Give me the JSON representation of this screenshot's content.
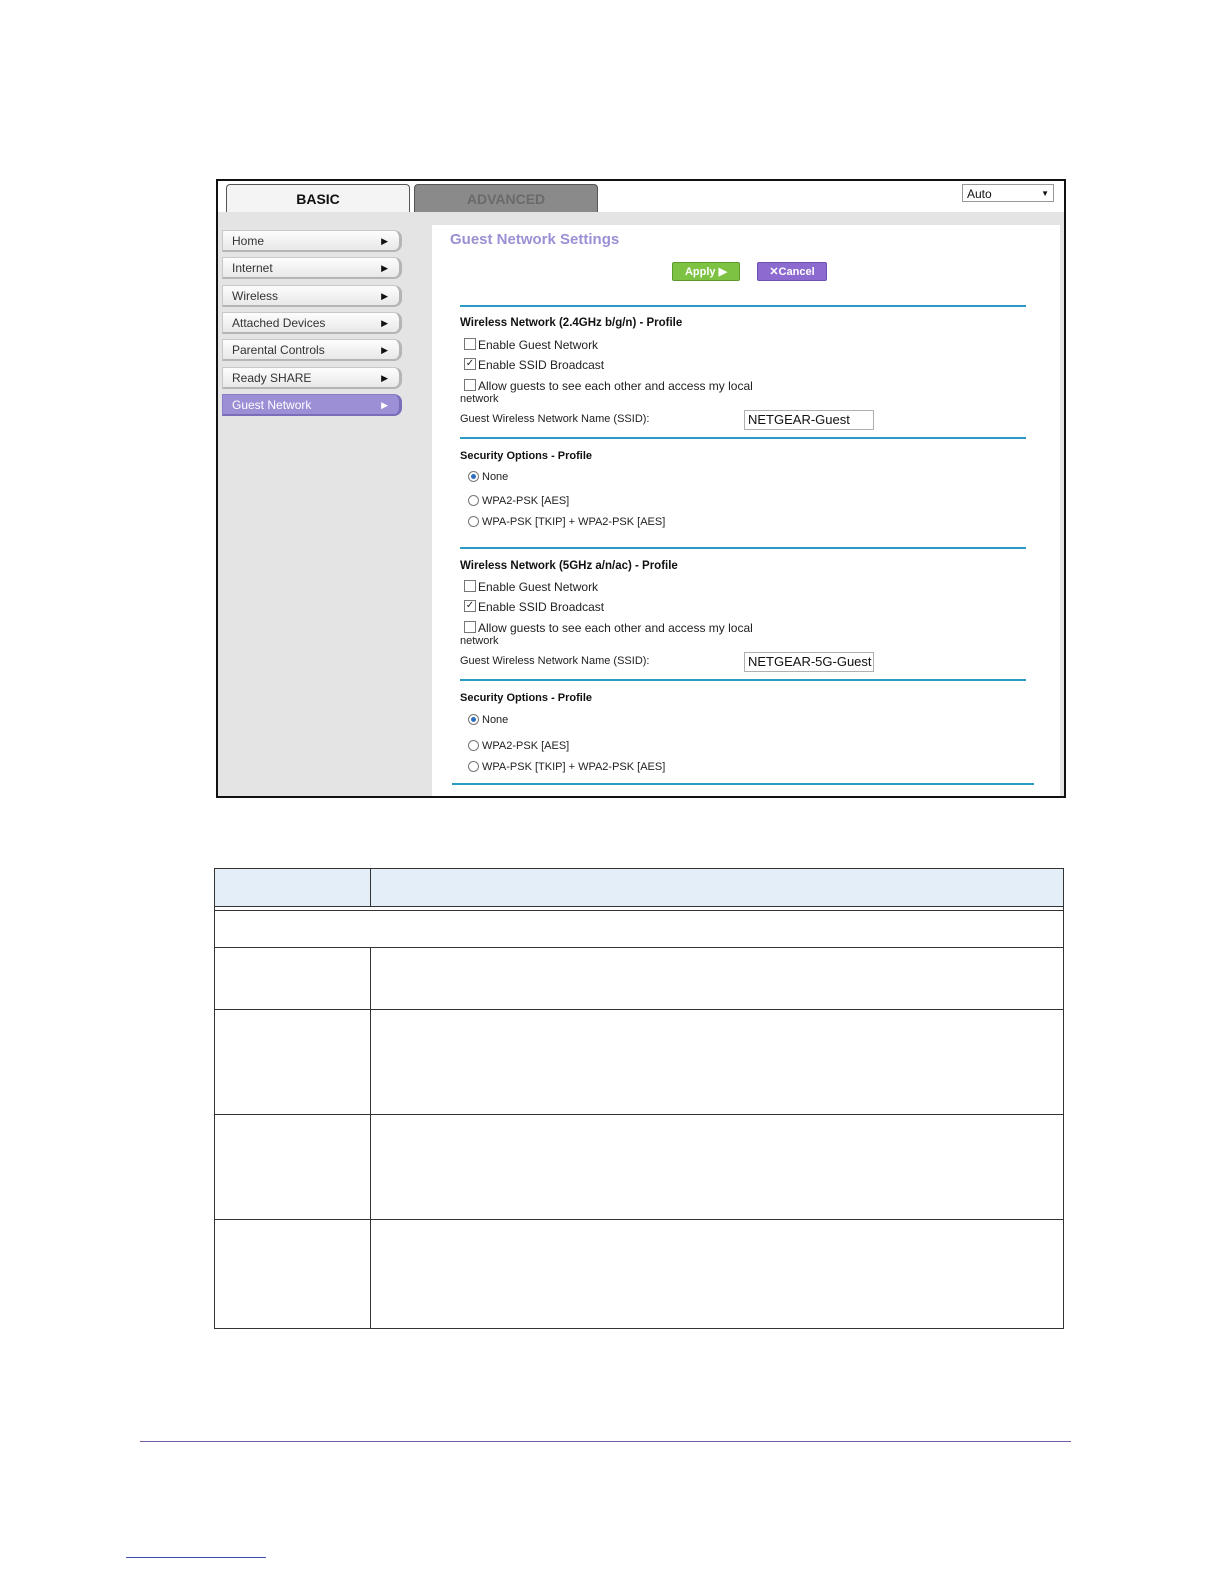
{
  "tabs": {
    "basic": "BASIC",
    "advanced": "ADVANCED"
  },
  "language_select": {
    "value": "Auto"
  },
  "sidebar": {
    "items": [
      {
        "label": "Home"
      },
      {
        "label": "Internet"
      },
      {
        "label": "Wireless"
      },
      {
        "label": "Attached Devices"
      },
      {
        "label": "Parental Controls"
      },
      {
        "label": "Ready SHARE"
      },
      {
        "label": "Guest Network"
      }
    ],
    "active": "Guest Network"
  },
  "page": {
    "title": "Guest Network Settings",
    "apply_label": "Apply ▶",
    "cancel_label": "✕Cancel"
  },
  "network_24": {
    "heading": "Wireless Network (2.4GHz b/g/n) - Profile",
    "enable_guest": {
      "label": "Enable Guest Network",
      "checked": false
    },
    "ssid_broadcast": {
      "label": "Enable SSID Broadcast",
      "checked": true
    },
    "allow_guests": {
      "label_line1": "Allow guests to see each other and access my local",
      "label_line2": "network",
      "checked": false
    },
    "ssid_label": "Guest Wireless Network Name (SSID):",
    "ssid_value": "NETGEAR-Guest"
  },
  "security_24": {
    "heading": "Security Options - Profile",
    "options": [
      "None",
      "WPA2-PSK [AES]",
      "WPA-PSK [TKIP] + WPA2-PSK [AES]"
    ],
    "selected": "None"
  },
  "network_5": {
    "heading": "Wireless Network (5GHz a/n/ac) - Profile",
    "enable_guest": {
      "label": "Enable Guest Network",
      "checked": false
    },
    "ssid_broadcast": {
      "label": "Enable SSID Broadcast",
      "checked": true
    },
    "allow_guests": {
      "label_line1": "Allow guests to see each other and access my local",
      "label_line2": "network",
      "checked": false
    },
    "ssid_label": "Guest Wireless Network Name (SSID):",
    "ssid_value": "NETGEAR-5G-Guest"
  },
  "security_5": {
    "heading": "Security Options - Profile",
    "options": [
      "None",
      "WPA2-PSK [AES]",
      "WPA-PSK [TKIP] + WPA2-PSK [AES]"
    ],
    "selected": "None"
  },
  "icons": {
    "checkmark": "✓",
    "arrow": "▶",
    "dropdown": "▼"
  },
  "colors": {
    "accent_purple": "#9a90d4",
    "apply_green": "#7dc243",
    "cancel_purple": "#8c6ad0",
    "rule_blue": "#2a9bc4",
    "table_header": "#e3eef9"
  }
}
